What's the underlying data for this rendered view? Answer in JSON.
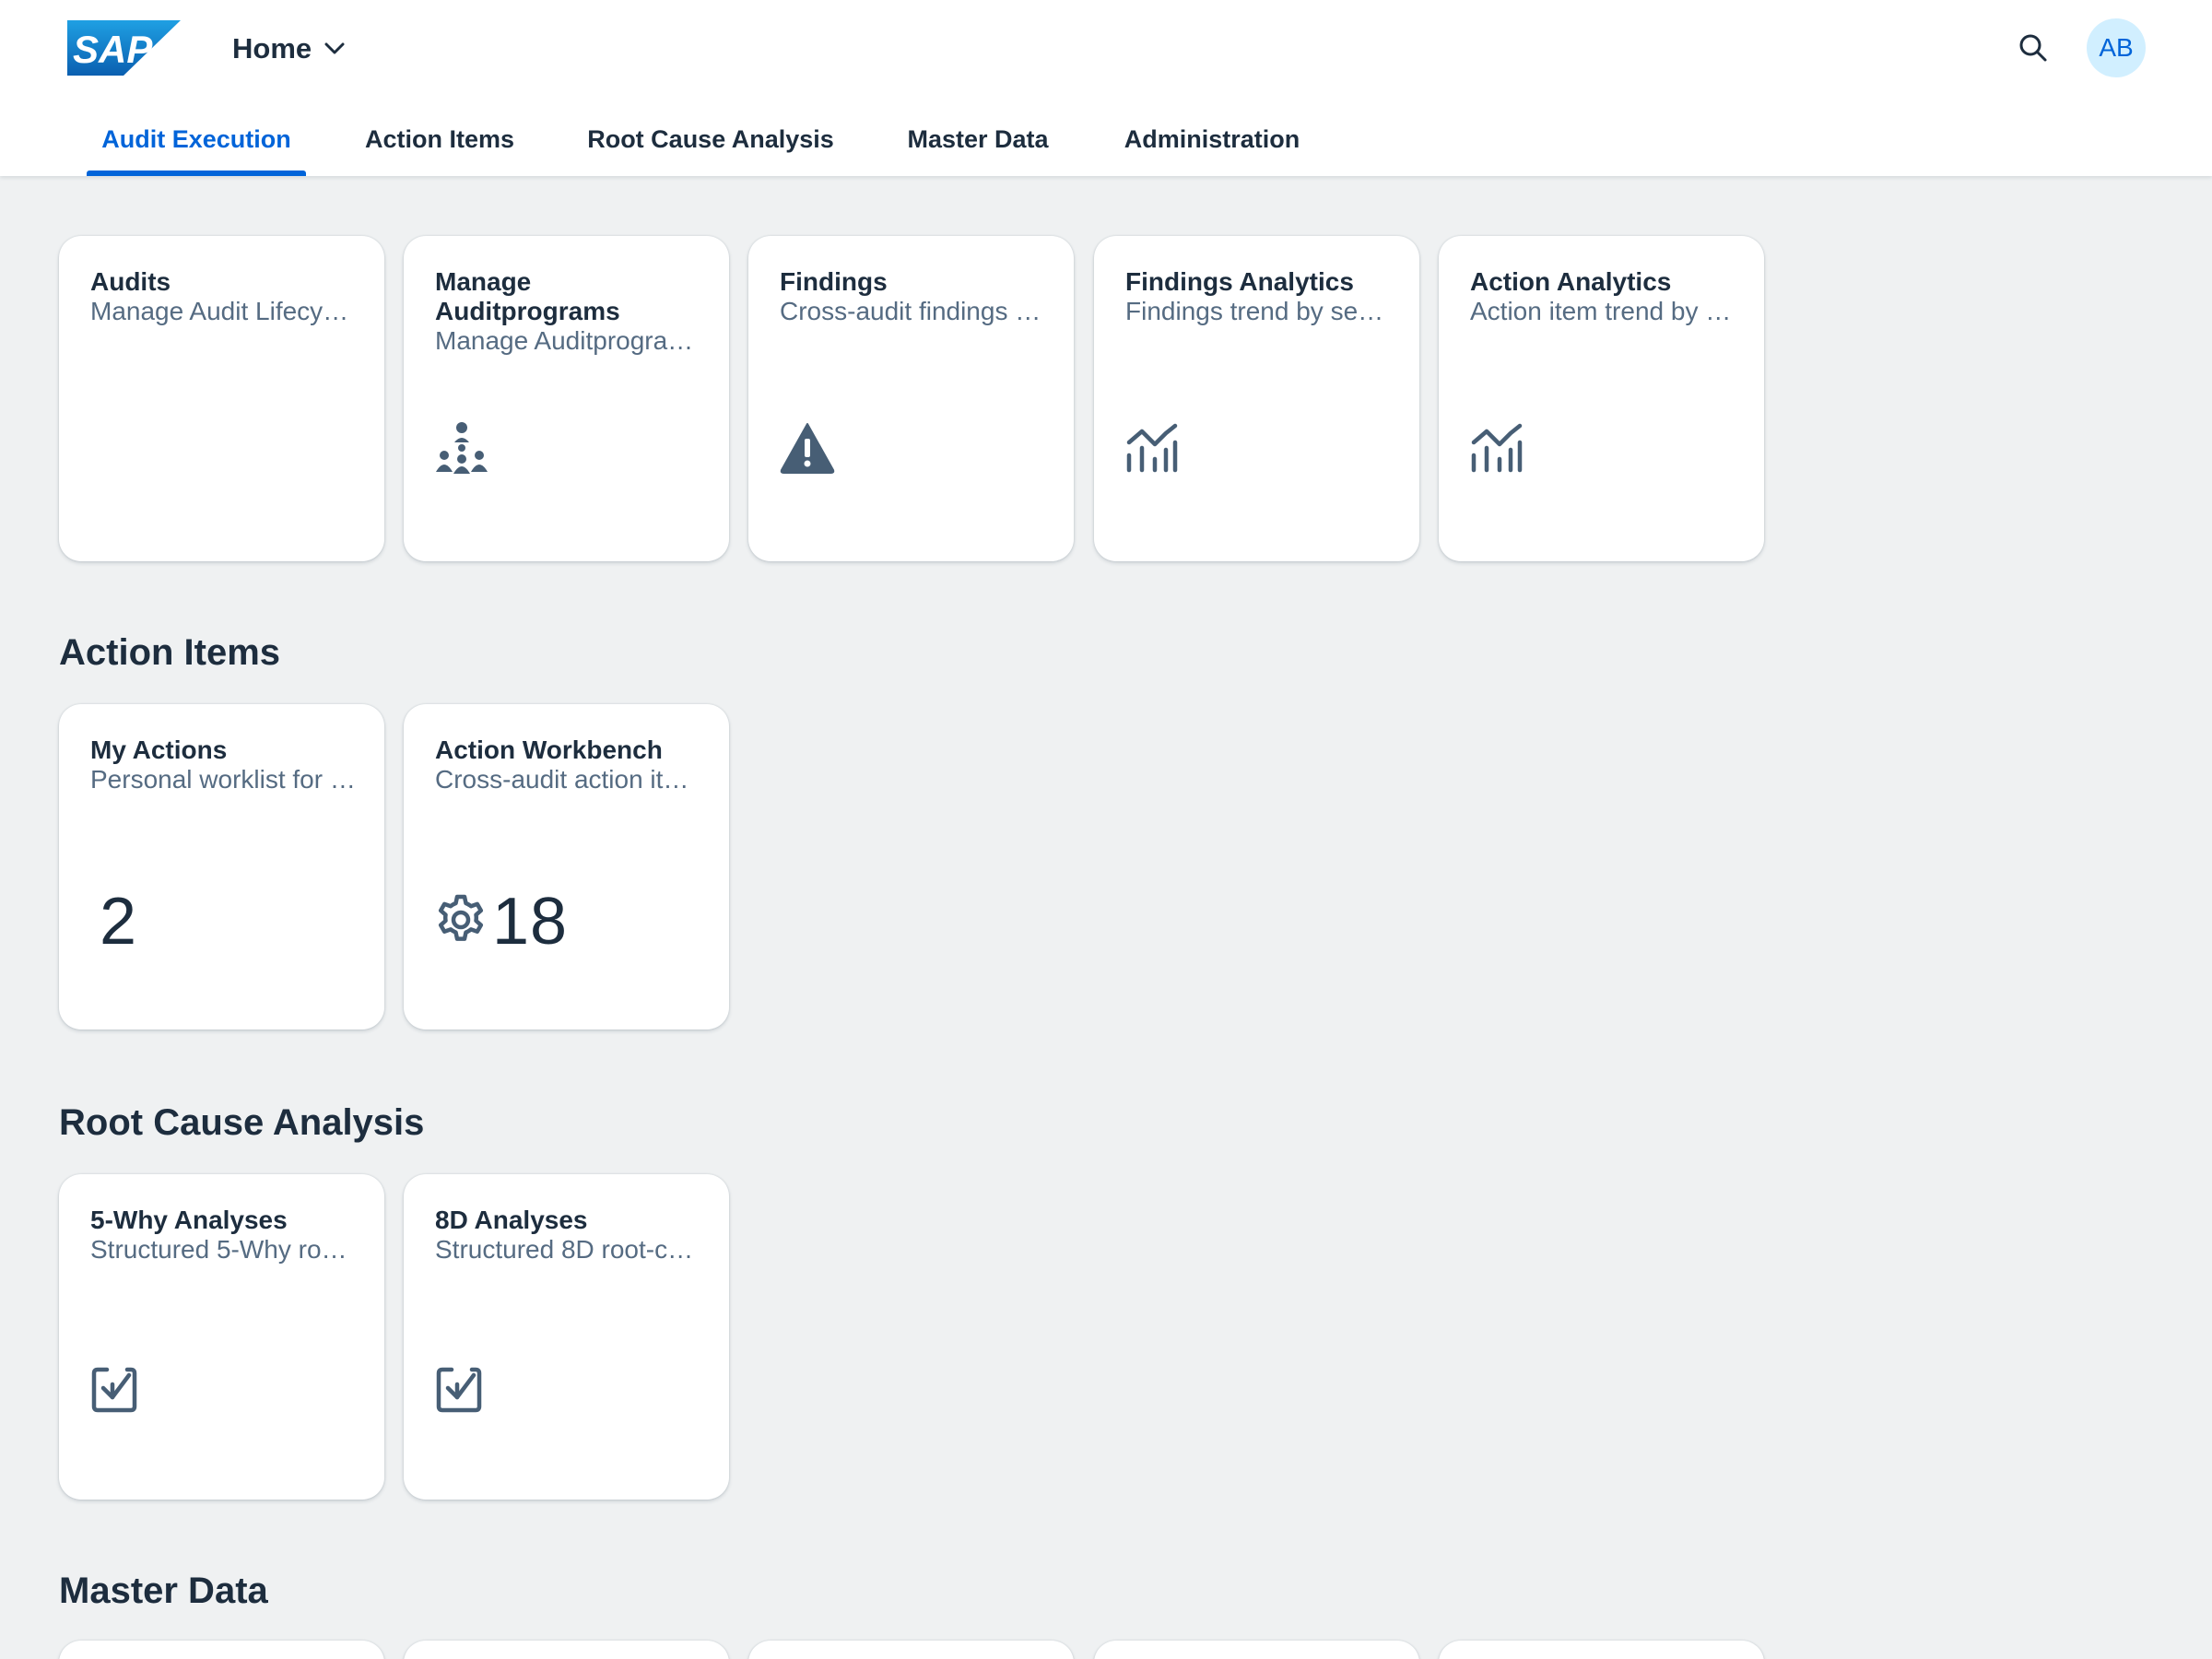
{
  "shell": {
    "logo_text": "SAP",
    "home_label": "Home",
    "avatar_initials": "AB",
    "accent_color": "#0064d9"
  },
  "tabs": [
    {
      "label": "Audit Execution",
      "selected": true
    },
    {
      "label": "Action Items",
      "selected": false
    },
    {
      "label": "Root Cause Analysis",
      "selected": false
    },
    {
      "label": "Master Data",
      "selected": false
    },
    {
      "label": "Administration",
      "selected": false
    }
  ],
  "audit_execution": {
    "tiles": [
      {
        "title": "Audits",
        "subtitle": "Manage Audit Lifecy…",
        "icon": "none"
      },
      {
        "title": "Manage Auditprograms",
        "subtitle": "Manage Auditprogra…",
        "icon": "hierarchy-icon"
      },
      {
        "title": "Findings",
        "subtitle": "Cross-audit findings …",
        "icon": "warning-icon"
      },
      {
        "title": "Findings Analytics",
        "subtitle": "Findings trend by se…",
        "icon": "line-chart-icon"
      },
      {
        "title": "Action Analytics",
        "subtitle": "Action item trend by …",
        "icon": "line-chart-icon"
      }
    ]
  },
  "action_items": {
    "title": "Action Items",
    "tiles": [
      {
        "title": "My Actions",
        "subtitle": "Personal worklist for …",
        "kpi": "2",
        "icon": "none"
      },
      {
        "title": "Action Workbench",
        "subtitle": "Cross-audit action it…",
        "kpi": "18",
        "icon": "gear-icon"
      }
    ]
  },
  "root_cause_analysis": {
    "title": "Root Cause Analysis",
    "tiles": [
      {
        "title": "5-Why Analyses",
        "subtitle": "Structured 5-Why ro…",
        "icon": "task-icon"
      },
      {
        "title": "8D Analyses",
        "subtitle": "Structured 8D root-c…",
        "icon": "task-icon"
      }
    ]
  },
  "master_data": {
    "title": "Master Data"
  }
}
